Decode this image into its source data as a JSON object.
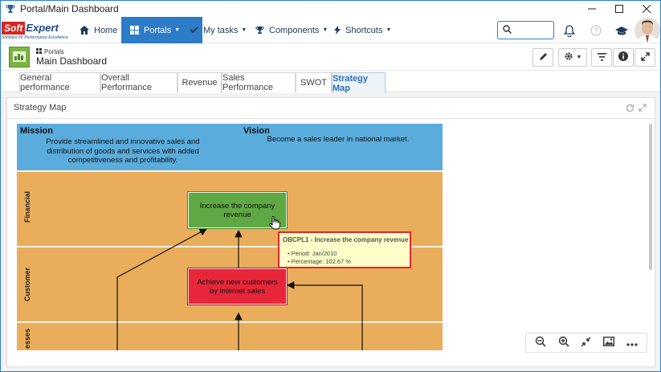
{
  "window": {
    "title": "Portal/Main Dashboard"
  },
  "brand": {
    "name_part1": "Soft",
    "name_part2": "Expert",
    "tagline": "Software for Performance Excellence"
  },
  "nav": {
    "items": [
      {
        "label": "Home",
        "icon": "home-icon"
      },
      {
        "label": "Portals",
        "icon": "portals-grid-icon",
        "active": true
      },
      {
        "label": "My tasks",
        "icon": "check-icon"
      },
      {
        "label": "Components",
        "icon": "trophy-icon"
      },
      {
        "label": "Shortcuts",
        "icon": "bolt-icon"
      }
    ],
    "search": {
      "placeholder": ""
    }
  },
  "page": {
    "breadcrumb": "Portals",
    "title": "Main Dashboard"
  },
  "tabs": [
    {
      "label": "General performance"
    },
    {
      "label": "Overall Performance"
    },
    {
      "label": "Revenue"
    },
    {
      "label": "Sales Performance"
    },
    {
      "label": "SWOT"
    },
    {
      "label": "Strategy Map",
      "active": true
    }
  ],
  "panel": {
    "title": "Strategy Map"
  },
  "strategy_map": {
    "mission": {
      "label": "Mission",
      "text": "Provide streamlined and innovative sales and distribution of goods and services with added competitiveness and profitability."
    },
    "vision": {
      "label": "Vision",
      "text": "Become a sales leader in national market."
    },
    "perspectives": [
      {
        "label": "Financial"
      },
      {
        "label": "Customer"
      },
      {
        "label": "esses"
      }
    ],
    "objectives": [
      {
        "label": "Increase the company revenue",
        "status_color": "#5fa843"
      },
      {
        "label": "Achieve new customers by internet sales",
        "status_color": "#e8263a"
      }
    ]
  },
  "tooltip": {
    "title": "OBCPL1 - Increase the company revenue",
    "period": "Period: Jan/2010",
    "percentage": "Percentage: 102.67 %"
  },
  "colors": {
    "accent": "#2c7cc7",
    "mission_band": "#5aacdc",
    "perspective_band": "#e9ad5b",
    "tooltip_border": "#e0292d"
  }
}
